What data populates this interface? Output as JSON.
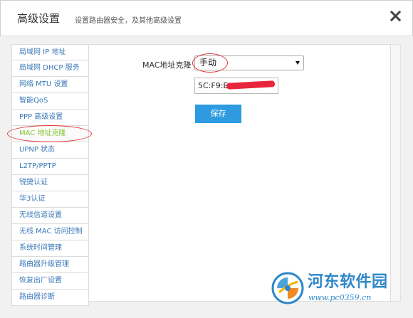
{
  "dialog": {
    "title": "高级设置",
    "subtitle": "设置路由器安全，及其他高级设置",
    "close_icon": "close-icon"
  },
  "sidebar": {
    "items": [
      {
        "label": "局域网 IP 地址"
      },
      {
        "label": "局域网 DHCP 服务"
      },
      {
        "label": "网络 MTU 设置"
      },
      {
        "label": "智能QoS"
      },
      {
        "label": "PPP 高级设置"
      },
      {
        "label": "MAC 地址克隆",
        "active": true
      },
      {
        "label": "UPNP 状态"
      },
      {
        "label": "L2TP/PPTP"
      },
      {
        "label": "锐捷认证"
      },
      {
        "label": "华3认证"
      },
      {
        "label": "无线信道设置"
      },
      {
        "label": "无线 MAC 访问控制"
      },
      {
        "label": "系统时间管理"
      },
      {
        "label": "路由器升级管理"
      },
      {
        "label": "恢复出厂设置"
      },
      {
        "label": "路由器诊断"
      }
    ]
  },
  "form": {
    "mac_clone_label": "MAC地址克隆",
    "mode_selected": "手动",
    "mac_value": "5C:F9:E",
    "save_label": "保存"
  },
  "watermark": {
    "name": "河东软件园",
    "url": "www.pc0359.cn"
  },
  "colors": {
    "link": "#3a79b8",
    "active": "#85c535",
    "button": "#2e9be0",
    "annotation": "#e23a3a",
    "watermark": "#2f87c8"
  }
}
